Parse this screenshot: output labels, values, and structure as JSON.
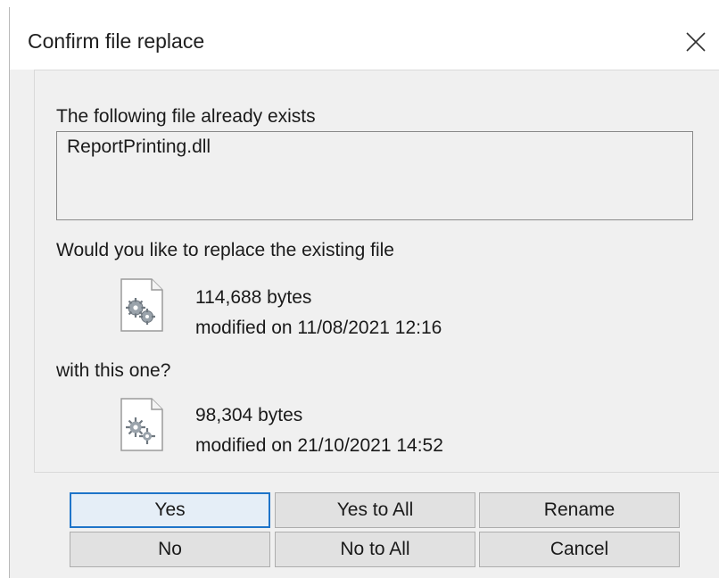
{
  "dialog": {
    "title": "Confirm file replace"
  },
  "message": {
    "exists_label": "The following file already exists",
    "filename": "ReportPrinting.dll",
    "replace_prompt": "Would you like to replace the existing file",
    "with_prompt": "with this one?"
  },
  "existing_file": {
    "size": "114,688 bytes",
    "modified": "modified on 11/08/2021 12:16",
    "icon": "dll-file-gears-icon"
  },
  "new_file": {
    "size": "98,304 bytes",
    "modified": "modified on 21/10/2021 14:52",
    "icon": "dll-file-gears-icon"
  },
  "buttons": {
    "yes": "Yes",
    "yes_to_all": "Yes to All",
    "rename": "Rename",
    "no": "No",
    "no_to_all": "No to All",
    "cancel": "Cancel"
  },
  "colors": {
    "focus_border": "#1e74c9",
    "button_face": "#e1e1e1",
    "client_background": "#f0f0f0"
  }
}
